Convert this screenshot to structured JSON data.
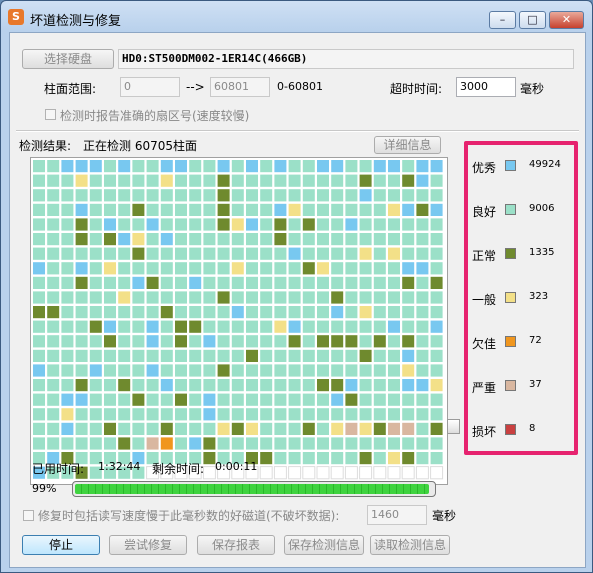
{
  "window": {
    "title": "坏道检测与修复",
    "app_icon_text": "S",
    "minimize": "–",
    "maximize": "□",
    "close": "✕"
  },
  "disk": {
    "select_button": "选择硬盘",
    "name": "HD0:ST500DM002-1ER14C(466GB)"
  },
  "range": {
    "label": "柱面范围:",
    "from": "0",
    "arrow": "-->",
    "to": "60801",
    "hint": "0-60801"
  },
  "timeout": {
    "label": "超时时间:",
    "value": "3000",
    "unit": "毫秒"
  },
  "option_report": "检测时报告准确的扇区号(速度较慢)",
  "result": {
    "label": "检测结果:",
    "status": "正在检测 60705柱面",
    "detail_button": "详细信息"
  },
  "legend": [
    {
      "label": "优秀",
      "count": "49924",
      "color": "#78c8f0"
    },
    {
      "label": "良好",
      "count": "9006",
      "color": "#9be0c8"
    },
    {
      "label": "正常",
      "count": "1335",
      "color": "#6f8a2e"
    },
    {
      "label": "一般",
      "count": "323",
      "color": "#f3e088"
    },
    {
      "label": "欠佳",
      "count": "72",
      "color": "#f0961e"
    },
    {
      "label": "严重",
      "count": "37",
      "color": "#d9b7a0"
    },
    {
      "label": "损坏",
      "count": "8",
      "color": "#c94040"
    }
  ],
  "time": {
    "elapsed_label": "已用时间:",
    "elapsed": "1:32:44",
    "remain_label": "剩余时间:",
    "remain": "0:00:11"
  },
  "progress": {
    "text": "99%",
    "value": 0.99
  },
  "repair_option": {
    "label": "修复时包括读写速度慢于此毫秒数的好磁道(不破坏数据):",
    "value": "1460",
    "unit": "毫秒"
  },
  "buttons": {
    "stop": "停止",
    "try_repair": "尝试修复",
    "save_report": "保存报表",
    "save_result": "保存检测信息",
    "load_result": "读取检测信息"
  }
}
